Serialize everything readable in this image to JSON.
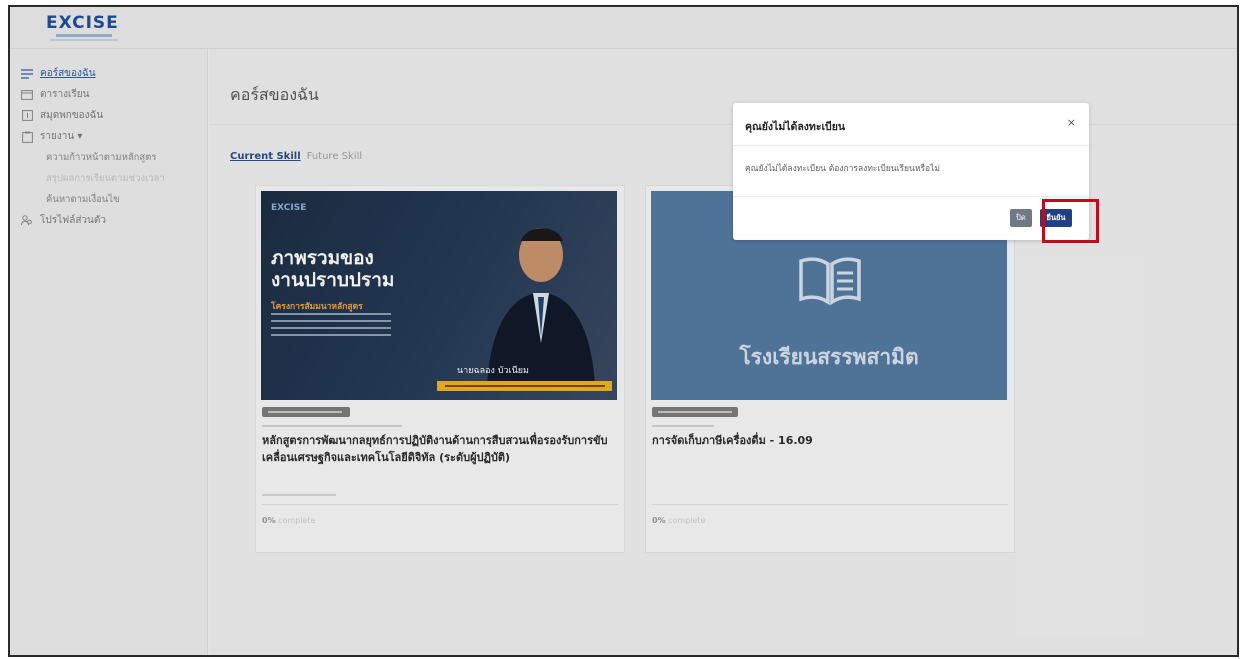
{
  "brand": {
    "logo_text": "EXCISE"
  },
  "sidebar": {
    "items": [
      {
        "label": "คอร์สของฉัน",
        "icon": "list-icon",
        "active": true
      },
      {
        "label": "ตารางเรียน",
        "icon": "calendar-icon"
      },
      {
        "label": "สมุดพกของฉัน",
        "icon": "notebook-icon"
      },
      {
        "label": "รายงาน ▾",
        "icon": "report-icon"
      }
    ],
    "sub_items": [
      {
        "label": "ความก้าวหน้าตามหลักสูตร"
      },
      {
        "label": "สรุปผลการเรียนตามช่วงเวลา"
      },
      {
        "label": "ค้นหาตามเงื่อนไข"
      }
    ],
    "profile": {
      "label": "โปรไฟล์ส่วนตัว",
      "icon": "users-icon"
    }
  },
  "page": {
    "title": "คอร์สของฉัน"
  },
  "tabs": {
    "current": "Current Skill",
    "future": "Future Skill"
  },
  "courses": [
    {
      "image": {
        "logo": "EXCISE",
        "headline_1": "ภาพรวมของ",
        "headline_2": "งานปราบปราม",
        "program": "โครงการสัมมนาหลักสูตร",
        "presenter": "นายฉลอง บัวเนียม"
      },
      "title": "หลักสูตรการพัฒนากลยุทธ์การปฏิบัติงานด้านการสืบสวนเพื่อรองรับการขับเคลื่อนเศรษฐกิจและเทคโนโลยีดิจิทัล (ระดับผู้ปฏิบัติ)",
      "progress_value": "0%",
      "progress_label": "complete"
    },
    {
      "image": {
        "headline": "โรงเรียนสรรพสามิต"
      },
      "title": "การจัดเก็บภาษีเครื่องดื่ม - 16.09",
      "progress_value": "0%",
      "progress_label": "complete"
    }
  ],
  "modal": {
    "title": "คุณยังไม่ได้ลงทะเบียน",
    "close_icon": "×",
    "message": "คุณยังไม่ได้ลงทะเบียน ต้องการลงทะเบียนเรียนหรือไม่",
    "close_button": "ปิด",
    "confirm_button": "ยืนยัน"
  },
  "colors": {
    "brand": "#1f4e9a",
    "confirm": "#1f3f86",
    "highlight": "#c3091b"
  }
}
